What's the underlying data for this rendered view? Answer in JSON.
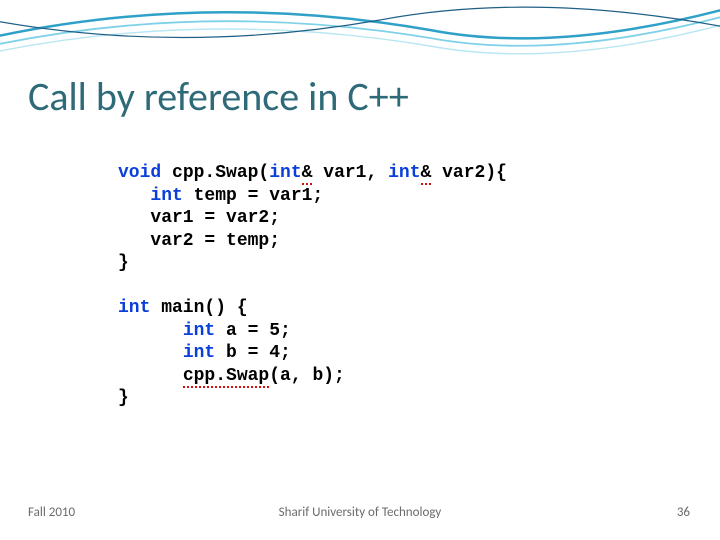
{
  "title": "Call by reference in C++",
  "code": {
    "k_void": "void",
    "fn1_name": " cpp.Swap(",
    "k_int1": "int",
    "amp1": "&",
    "arg1": " var1, ",
    "k_int2": "int",
    "amp2": "&",
    "arg2": " var2){",
    "l2a": "   ",
    "l2_kw": "int",
    "l2b": " temp = var1;",
    "l3": "   var1 = var2;",
    "l4": "   var2 = temp;",
    "l5": "}",
    "blank": "",
    "m1_kw": "int",
    "m1_rest": " main() {",
    "m2a": "      ",
    "m2_kw": "int",
    "m2b": " a = 5;",
    "m3a": "      ",
    "m3_kw": "int",
    "m3b": " b = 4;",
    "m4a": "      ",
    "m4_call": "cpp.Swap",
    "m4b": "(a, b);",
    "m5": "}"
  },
  "footer": {
    "left": "Fall 2010",
    "center": "Sharif University of Technology",
    "right": "36"
  }
}
